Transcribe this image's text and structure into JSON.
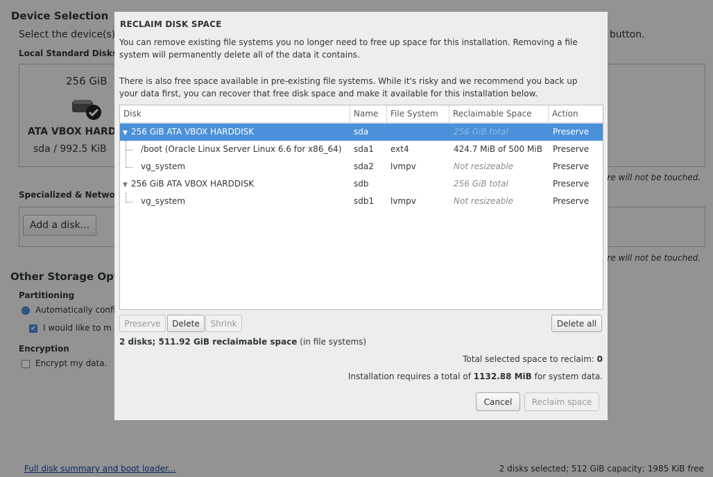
{
  "background": {
    "title": "Device Selection",
    "subtitle_start": "Select the device(s)",
    "subtitle_end": "\" button.",
    "local_disks_label": "Local Standard Disks",
    "disk": {
      "size": "256 GiB",
      "name": "ATA VBOX HARD",
      "detail": "sda  /  992.5 KiB"
    },
    "note_untouched": "ere will not be touched.",
    "specialized_label": "Specialized & Networ",
    "add_disk_button": "Add a disk...",
    "other_title": "Other Storage Opti",
    "partitioning_label": "Partitioning",
    "auto_config_label": "Automatically confi",
    "would_like_label": "I would like to m",
    "encryption_label": "Encryption",
    "encrypt_label": "Encrypt my data.",
    "footer_link": "Full disk summary and boot loader...",
    "footer_status": "2 disks selected; 512 GiB capacity; 1985 KiB free"
  },
  "dialog": {
    "title": "RECLAIM DISK SPACE",
    "para1": "You can remove existing file systems you no longer need to free up space for this installation.  Removing a file system will permanently delete all of the data it contains.",
    "para2": "There is also free space available in pre-existing file systems.  While it's risky and we recommend you back up your data first, you can recover that free disk space and make it available for this installation below.",
    "columns": {
      "disk": "Disk",
      "name": "Name",
      "filesystem": "File System",
      "reclaimable": "Reclaimable Space",
      "action": "Action"
    },
    "rows": [
      {
        "disk": "256 GiB ATA VBOX HARDDISK",
        "name": "sda",
        "fs": "",
        "reclaim": "256 GiB total",
        "action": "Preserve"
      },
      {
        "disk": "/boot (Oracle Linux Server Linux 6.6 for x86_64)",
        "name": "sda1",
        "fs": "ext4",
        "reclaim": "424.7 MiB of 500 MiB",
        "action": "Preserve"
      },
      {
        "disk": "vg_system",
        "name": "sda2",
        "fs": "lvmpv",
        "reclaim": "Not resizeable",
        "action": "Preserve"
      },
      {
        "disk": "256 GiB ATA VBOX HARDDISK",
        "name": "sdb",
        "fs": "",
        "reclaim": "256 GiB total",
        "action": "Preserve"
      },
      {
        "disk": "vg_system",
        "name": "sdb1",
        "fs": "lvmpv",
        "reclaim": "Not resizeable",
        "action": "Preserve"
      }
    ],
    "buttons": {
      "preserve": "Preserve",
      "delete": "Delete",
      "shrink": "Shrink",
      "delete_all": "Delete all",
      "cancel": "Cancel",
      "reclaim": "Reclaim space"
    },
    "summary_bold": "2 disks; 511.92 GiB reclaimable space",
    "summary_rest": " (in file systems)",
    "total_selected_label": "Total selected space to reclaim: ",
    "total_selected_value": "0",
    "requires_prefix": "Installation requires a total of ",
    "requires_value": "1132.88 MiB",
    "requires_suffix": " for system data."
  }
}
